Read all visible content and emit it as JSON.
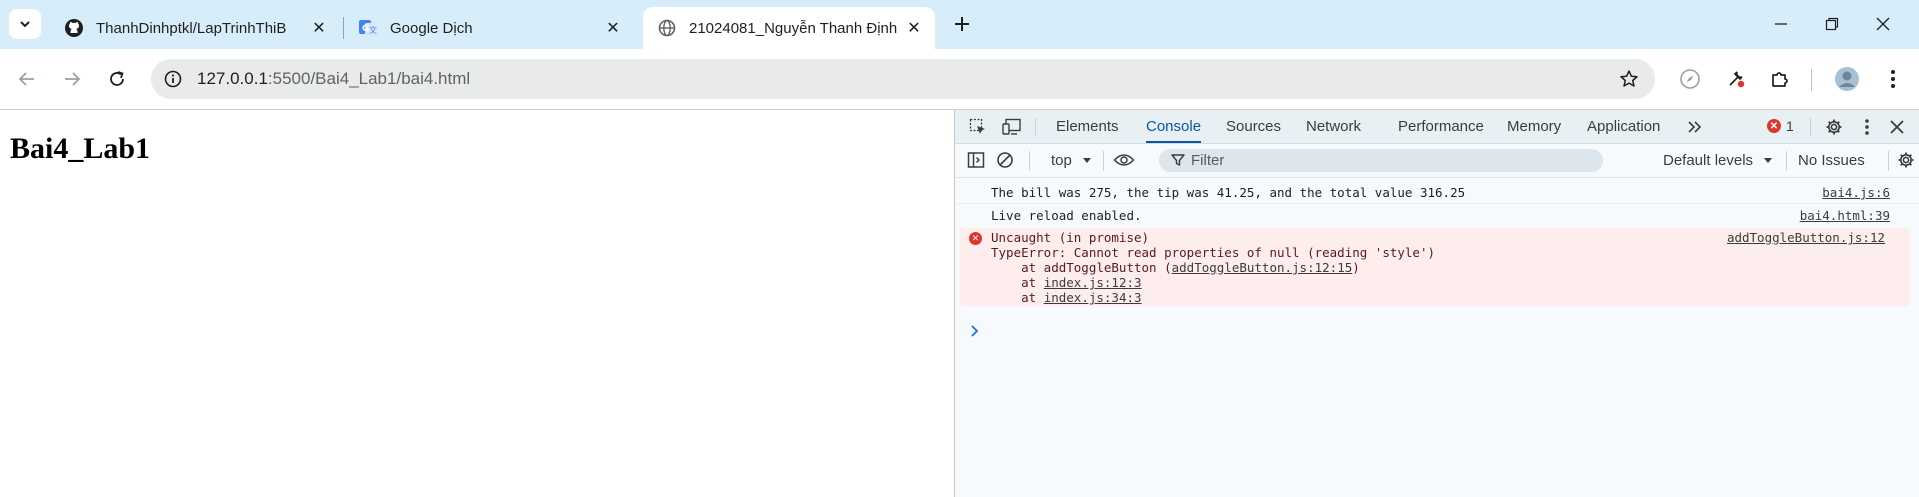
{
  "tabs": [
    {
      "title": "ThanhDinhptkl/LapTrinhThiBiDi",
      "icon": "github-icon",
      "active": false
    },
    {
      "title": "Google Dịch",
      "icon": "google-translate-icon",
      "active": false
    },
    {
      "title": "21024081_Nguyễn Thanh Định",
      "icon": "globe-icon",
      "active": true
    }
  ],
  "omnibox": {
    "host": "127.0.0.1",
    "path": ":5500/Bai4_Lab1/bai4.html"
  },
  "page": {
    "heading": "Bai4_Lab1"
  },
  "devtools": {
    "tabs": [
      "Elements",
      "Console",
      "Sources",
      "Network",
      "Performance",
      "Memory",
      "Application"
    ],
    "active_tab": "Console",
    "error_count": "1",
    "context": "top",
    "filter_placeholder": "Filter",
    "levels": "Default levels",
    "issues": "No Issues",
    "messages": [
      {
        "text": "The bill was 275, the tip was 41.25, and the total value 316.25",
        "source": "bai4.js:6"
      },
      {
        "text": "Live reload enabled.",
        "source": "bai4.html:39"
      }
    ],
    "error": {
      "line1": "Uncaught (in promise)",
      "line2": "TypeError: Cannot read properties of null (reading 'style')",
      "line3_prefix": "    at addToggleButton (",
      "line3_link": "addToggleButton.js:12:15",
      "line3_suffix": ")",
      "line4_prefix": "    at ",
      "line4_link": "index.js:12:3",
      "line5_prefix": "    at ",
      "line5_link": "index.js:34:3",
      "source": "addToggleButton.js:12"
    }
  },
  "colors": {
    "accent": "#0b57a0",
    "error": "#dc362e",
    "tabstrip": "#d7eefa"
  }
}
